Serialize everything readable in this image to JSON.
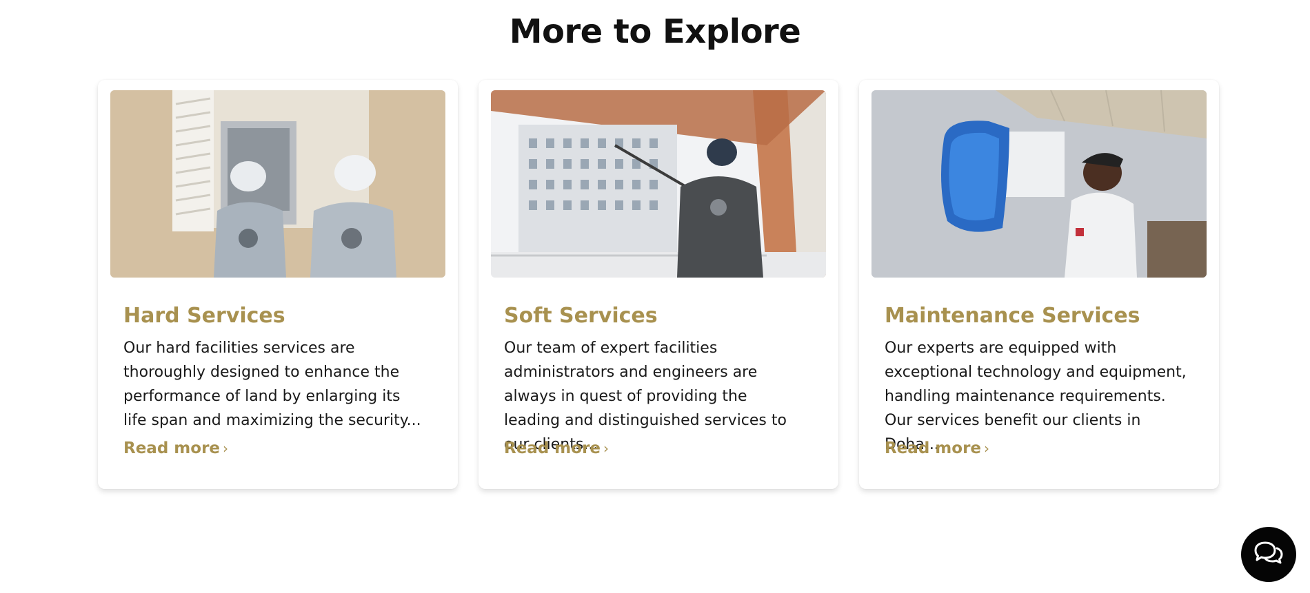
{
  "section": {
    "title": "More to Explore"
  },
  "cards": [
    {
      "title": "Hard Services",
      "description": "Our hard facilities services are thoroughly designed to enhance the performance of land by enlarging its life span and maximizing the security...",
      "link_label": "Read more",
      "image_icon": "electrical-panel-technicians-photo"
    },
    {
      "title": "Soft Services",
      "description": "Our team of expert facilities administrators and engineers are always in quest of providing the leading and distinguished services to our clients...",
      "link_label": "Read more",
      "image_icon": "window-cleaner-photo"
    },
    {
      "title": "Maintenance Services",
      "description": "Our experts are equipped with exceptional technology and equipment, handling maintenance requirements. Our services benefit our clients in Doha...",
      "link_label": "Read more",
      "image_icon": "ac-maintenance-technician-photo"
    }
  ],
  "chat": {
    "icon": "chat-bubbles-icon"
  },
  "colors": {
    "accent": "#a8914f",
    "text": "#1a1a1a",
    "chat_bg": "#050505"
  }
}
